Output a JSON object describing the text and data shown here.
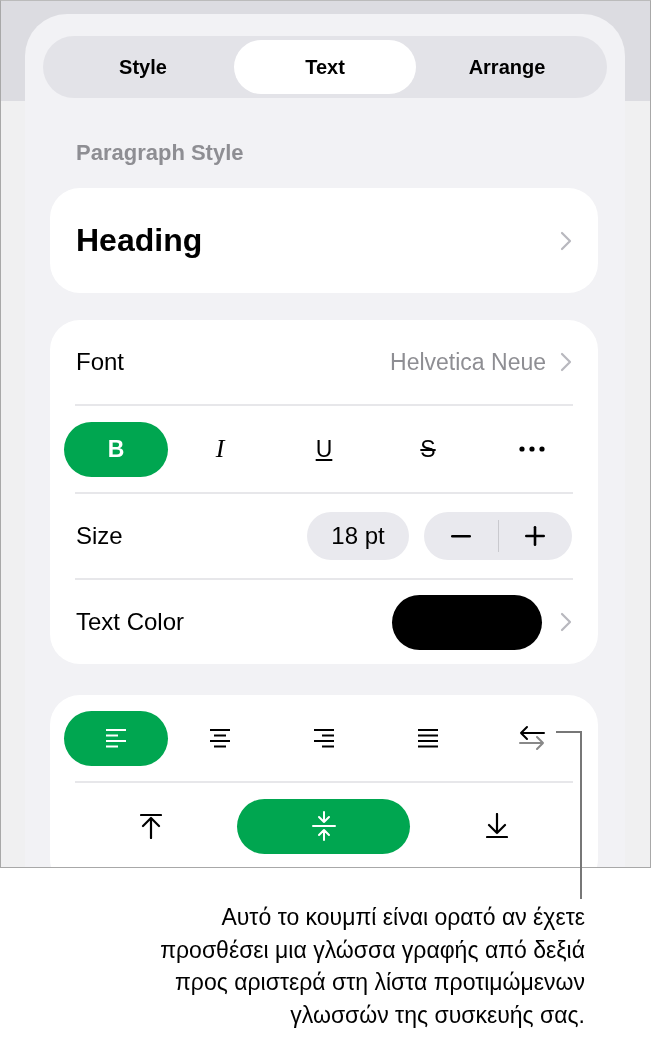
{
  "tabs": [
    {
      "label": "Style",
      "selected": false
    },
    {
      "label": "Text",
      "selected": true
    },
    {
      "label": "Arrange",
      "selected": false
    }
  ],
  "paragraph_style": {
    "label": "Paragraph Style",
    "value": "Heading"
  },
  "font": {
    "label": "Font",
    "value": "Helvetica Neue"
  },
  "text_styles": [
    {
      "label": "B",
      "kind": "bold",
      "selected": true
    },
    {
      "label": "I",
      "kind": "italic",
      "selected": false
    },
    {
      "label": "U",
      "kind": "underline",
      "selected": false
    },
    {
      "label": "S",
      "kind": "strikethrough",
      "selected": false
    }
  ],
  "size": {
    "label": "Size",
    "value": "18 pt"
  },
  "text_color": {
    "label": "Text Color",
    "color": "#000000"
  },
  "alignment": [
    {
      "kind": "left",
      "selected": true
    },
    {
      "kind": "center",
      "selected": false
    },
    {
      "kind": "right",
      "selected": false
    },
    {
      "kind": "justify",
      "selected": false
    },
    {
      "kind": "direction",
      "selected": false
    }
  ],
  "vertical_alignment": [
    {
      "kind": "top",
      "selected": false
    },
    {
      "kind": "middle",
      "selected": true
    },
    {
      "kind": "bottom",
      "selected": false
    }
  ],
  "callout": {
    "lines": [
      "Αυτό το κουμπί είναι ορατό αν έχετε",
      "προσθέσει μια γλώσσα γραφής από δεξιά",
      "προς αριστερά στη λίστα προτιμώμενων",
      "γλωσσών της συσκευής σας."
    ]
  }
}
